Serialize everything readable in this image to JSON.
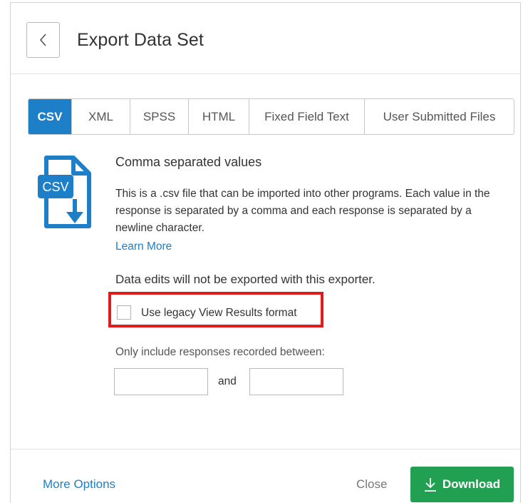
{
  "dialog": {
    "title": "Export Data Set",
    "back_icon": "chevron-left-icon"
  },
  "tabs": [
    {
      "label": "CSV",
      "active": true
    },
    {
      "label": "XML",
      "active": false
    },
    {
      "label": "SPSS",
      "active": false
    },
    {
      "label": "HTML",
      "active": false
    },
    {
      "label": "Fixed Field Text",
      "active": false
    },
    {
      "label": "User Submitted Files",
      "active": false
    }
  ],
  "format": {
    "icon": "csv-file-download-icon",
    "icon_text": "CSV",
    "name": "Comma separated values",
    "description": "This is a .csv file that can be imported into other programs. Each value in the response is separated by a comma and each response is separated by a newline character.",
    "learn_more": "Learn More",
    "warning": "Data edits will not be exported with this exporter."
  },
  "options": {
    "legacy_label": "Use legacy View Results format",
    "legacy_checked": false,
    "range_label": "Only include responses recorded between:",
    "and_label": "and",
    "date_from": "",
    "date_to": ""
  },
  "footer": {
    "more_options": "More Options",
    "close": "Close",
    "download": "Download",
    "download_icon": "download-arrow-icon"
  },
  "colors": {
    "accent": "#1c7fc7",
    "download": "#20a050",
    "highlight": "#e01b1b"
  }
}
